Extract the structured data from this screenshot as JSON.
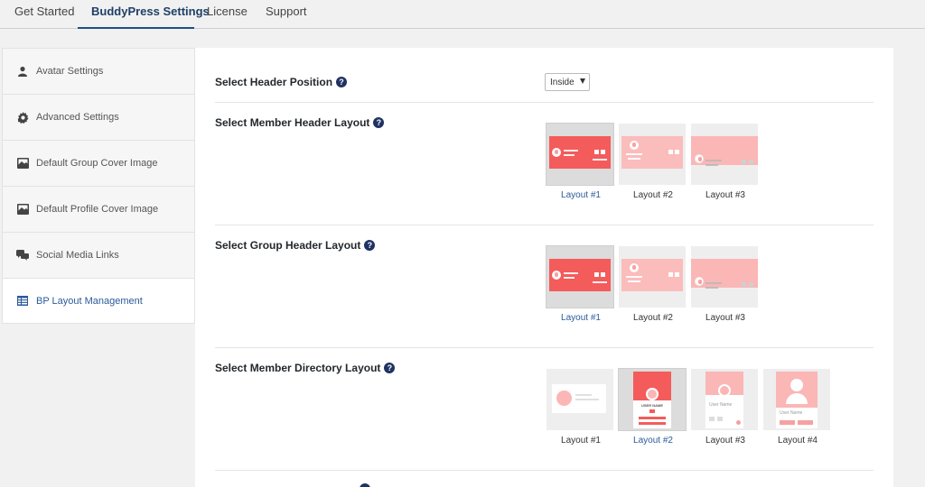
{
  "tabs": [
    {
      "label": "Get Started"
    },
    {
      "label": "BuddyPress Settings"
    },
    {
      "label": "License"
    },
    {
      "label": "Support"
    }
  ],
  "sidebar": {
    "items": [
      {
        "label": "Avatar Settings",
        "icon": "user-icon"
      },
      {
        "label": "Advanced Settings",
        "icon": "gear-icon"
      },
      {
        "label": "Default Group Cover Image",
        "icon": "image-icon"
      },
      {
        "label": "Default Profile Cover Image",
        "icon": "image-icon"
      },
      {
        "label": "Social Media Links",
        "icon": "chat-bubbles-icon"
      },
      {
        "label": "BP Layout Management",
        "icon": "table-icon"
      }
    ]
  },
  "settings": {
    "header_position": {
      "label": "Select Header Position",
      "value": "Inside"
    },
    "member_header": {
      "label": "Select Member Header Layout",
      "options": [
        "Layout #1",
        "Layout #2",
        "Layout #3"
      ],
      "selected": "Layout #1"
    },
    "group_header": {
      "label": "Select Group Header Layout",
      "options": [
        "Layout #1",
        "Layout #2",
        "Layout #3"
      ],
      "selected": "Layout #1"
    },
    "member_directory": {
      "label": "Select Member Directory Layout",
      "options": [
        "Layout #1",
        "Layout #2",
        "Layout #3",
        "Layout #4"
      ],
      "selected": "Layout #2"
    }
  },
  "thumbnail_text": {
    "user_name": "User Name",
    "user_name_upper": "USER NAME"
  },
  "help_glyph": "?",
  "colors": {
    "accent": "#2a5a99",
    "layout_red": "#f45b5b",
    "layout_pink": "#fbbcbc",
    "help_bg": "#1f3262"
  }
}
